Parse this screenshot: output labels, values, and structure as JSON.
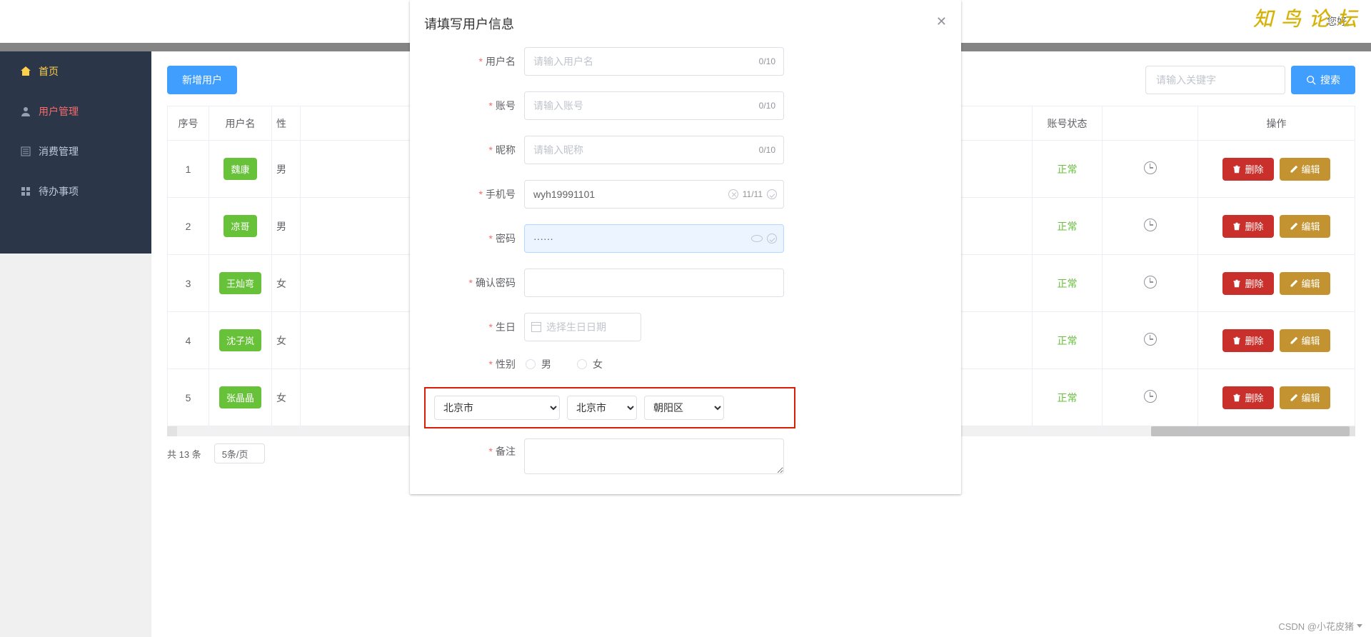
{
  "header": {
    "greeting": "您好,"
  },
  "watermark_top": "知 鸟 论 坛",
  "footer_wm": "CSDN @小花皮猪",
  "sidebar": {
    "items": [
      {
        "label": "首页"
      },
      {
        "label": "用户管理"
      },
      {
        "label": "消费管理"
      },
      {
        "label": "待办事项"
      }
    ]
  },
  "toolbar": {
    "add_label": "新增用户",
    "search_placeholder": "请输入关键字",
    "search_btn": "搜索"
  },
  "table": {
    "headers": {
      "idx": "序号",
      "name": "用户名",
      "sex": "性",
      "status": "账号状态",
      "op": "操作"
    },
    "rows": [
      {
        "idx": "1",
        "name": "魏康",
        "sex": "男",
        "status": "正常"
      },
      {
        "idx": "2",
        "name": "凉哥",
        "sex": "男",
        "status": "正常"
      },
      {
        "idx": "3",
        "name": "王灿弯",
        "sex": "女",
        "status": "正常"
      },
      {
        "idx": "4",
        "name": "沈子岚",
        "sex": "女",
        "status": "正常"
      },
      {
        "idx": "5",
        "name": "张晶晶",
        "sex": "女",
        "status": "正常"
      }
    ],
    "op_delete": "删除",
    "op_edit": "编辑"
  },
  "pager": {
    "total": "共 13 条",
    "size": "5条/页"
  },
  "dialog": {
    "title": "请填写用户信息",
    "fields": {
      "username": {
        "label": "用户名",
        "placeholder": "请输入用户名",
        "counter": "0/10"
      },
      "account": {
        "label": "账号",
        "placeholder": "请输入账号",
        "counter": "0/10"
      },
      "nickname": {
        "label": "昵称",
        "placeholder": "请输入昵称",
        "counter": "0/10"
      },
      "phone": {
        "label": "手机号",
        "value": "wyh19991101",
        "counter": "11/11"
      },
      "password": {
        "label": "密码",
        "value": "······"
      },
      "confirm": {
        "label": "确认密码"
      },
      "birthday": {
        "label": "生日",
        "placeholder": "选择生日日期"
      },
      "gender": {
        "label": "性别",
        "male": "男",
        "female": "女"
      },
      "remark": {
        "label": "备注"
      }
    },
    "region": {
      "province": "北京市",
      "city": "北京市",
      "district": "朝阳区"
    }
  }
}
